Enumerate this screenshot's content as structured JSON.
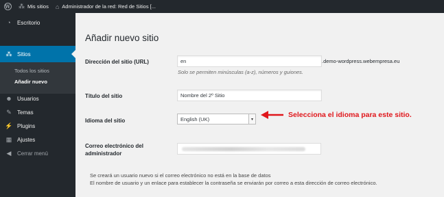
{
  "adminbar": {
    "my_sites": "Mis sitios",
    "network_admin": "Administrador de la red: Red de Sitios [..."
  },
  "sidebar": {
    "items": [
      {
        "label": "Escritorio",
        "icon": "dashboard-icon"
      },
      {
        "label": "Sitios",
        "icon": "sites-icon"
      },
      {
        "label": "Usuarios",
        "icon": "users-icon"
      },
      {
        "label": "Temas",
        "icon": "themes-icon"
      },
      {
        "label": "Plugins",
        "icon": "plugins-icon"
      },
      {
        "label": "Ajustes",
        "icon": "settings-icon"
      },
      {
        "label": "Cerrar menú",
        "icon": "collapse-icon"
      }
    ],
    "submenu": [
      "Todos los sitios",
      "Añadir nuevo"
    ]
  },
  "main": {
    "title": "Añadir nuevo sitio",
    "url": {
      "label": "Dirección del sitio (URL)",
      "value": "en",
      "suffix": ".demo-wordpress.webempresa.eu",
      "hint": "Solo se permiten minúsculas (a-z), números y guiones."
    },
    "site_title": {
      "label": "Título del sitio",
      "value": "Nombre del 2º Sitio"
    },
    "language": {
      "label": "Idioma del sitio",
      "value": "English (UK)"
    },
    "admin_email": {
      "label_line1": "Correo electrónico del",
      "label_line2": "administrador"
    },
    "notes": [
      "Se creará un usuario nuevo si el correo electrónico no está en la base de datos",
      "El nombre de usuario y un enlace para establecer la contraseña se enviarán por correo a esta dirección de correo electrónico."
    ]
  },
  "annotation": {
    "text": "Selecciona el idioma para este sitio.",
    "color": "#e0161b"
  },
  "colors": {
    "adminbar_bg": "#23282d",
    "sidebar_bg": "#23282d",
    "active_menu": "#0073aa",
    "submenu_bg": "#32373c",
    "page_bg": "#f1f1f1"
  }
}
